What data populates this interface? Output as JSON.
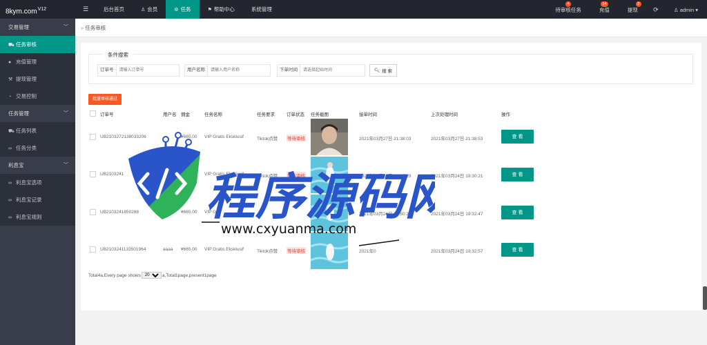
{
  "app": {
    "logo": "8kym.com",
    "logo_version": "V12"
  },
  "topnav": {
    "items": [
      {
        "label": "后台首页"
      },
      {
        "label": "会员"
      },
      {
        "label": "任务"
      },
      {
        "label": "帮助中心"
      },
      {
        "label": "系统管理"
      }
    ],
    "active_index": 2
  },
  "header_right": {
    "pending_tasks": {
      "label": "待审核任务",
      "badge": "4"
    },
    "recharge": {
      "label": "充值",
      "badge": "14"
    },
    "withdraw": {
      "label": "提现",
      "badge": "3"
    },
    "user": {
      "label": "admin"
    }
  },
  "sidebar": {
    "groups": [
      {
        "label": "交易管理",
        "items": [
          {
            "label": "任务审核",
            "icon": "cart-icon"
          },
          {
            "label": "充值管理",
            "icon": "chat-icon"
          },
          {
            "label": "提现管理",
            "icon": "hammer-icon"
          },
          {
            "label": "交易控制",
            "icon": "gauge-icon"
          }
        ]
      },
      {
        "label": "任务管理",
        "items": [
          {
            "label": "任务列表",
            "icon": "cart-icon"
          },
          {
            "label": "任务分类",
            "icon": "link-icon"
          }
        ]
      },
      {
        "label": "利息宝",
        "items": [
          {
            "label": "利息宝选项",
            "icon": "link-icon"
          },
          {
            "label": "利息宝记录",
            "icon": "link-icon"
          },
          {
            "label": "利息宝规则",
            "icon": "link-icon"
          }
        ]
      }
    ],
    "active": "任务审核"
  },
  "breadcrumb": {
    "label": "任务审核"
  },
  "filter": {
    "legend": "条件搜索",
    "order_label": "订单号",
    "order_placeholder": "请输入订单号",
    "username_label": "用户名称",
    "username_placeholder": "请输入用户名称",
    "time_label": "下单时间",
    "time_placeholder": "请选择起始时间",
    "search_label": "搜 索"
  },
  "batch_button": "批量审核通过",
  "table": {
    "columns": [
      "订单号",
      "用户名",
      "佣金",
      "任务名称",
      "任务要求",
      "订单状态",
      "任务截图",
      "接单时间",
      "上次处理时间",
      "操作"
    ],
    "rows": [
      {
        "order_id": "UB2103272138033206",
        "username": "",
        "commission": "¥665.00",
        "task_name": "VIP Gratis Eksklusif",
        "requirement": "Tiktok点赞",
        "status": "等待审核",
        "accept_time": "2021年03月27日 21:38:03",
        "last_time": "2021年03月27日 21:38:53",
        "action": "查 看",
        "screenshot": "portrait"
      },
      {
        "order_id": "UB2103241",
        "username": "",
        "commission": "",
        "task_name": "VIP Gratis Eksklusif",
        "requirement": "Tiktok点赞",
        "status": "等待审核",
        "accept_time": "2021年03月24日 19:21:29",
        "last_time": "2021年03月24日 19:30:21",
        "action": "查 看",
        "screenshot": "swimmer"
      },
      {
        "order_id": "UB2103241850288",
        "username": "",
        "commission": "¥665.00",
        "task_name": "VIP Gr",
        "requirement": "",
        "status": "",
        "accept_time": "2021年03月24日 18:50:28",
        "last_time": "2021年03月24日 19:32:47",
        "action": "查 看",
        "screenshot": "swimmer"
      },
      {
        "order_id": "UB2103241133501964",
        "username": "aaaa",
        "commission": "¥665.00",
        "task_name": "VIP Gratis Eksklusif",
        "requirement": "Tiktok点赞",
        "status": "等待审核",
        "accept_time": "2021年0",
        "last_time": "2021年03月24日 19:32:57",
        "action": "查 看",
        "screenshot": "swimmer"
      }
    ]
  },
  "pager": {
    "prefix": "Total4a,Every page shows",
    "page_size": "20",
    "suffix": "a,Total1page,present1page"
  },
  "watermark": {
    "text_cn": "程序源码网",
    "url": "www.cxyuanma.com",
    "colors": {
      "blue": "#2a55c9",
      "green": "#2fb35a"
    }
  },
  "colors": {
    "accent": "#009688",
    "danger": "#ff5722",
    "topbar": "#23262e",
    "sidebar": "#393d49"
  }
}
